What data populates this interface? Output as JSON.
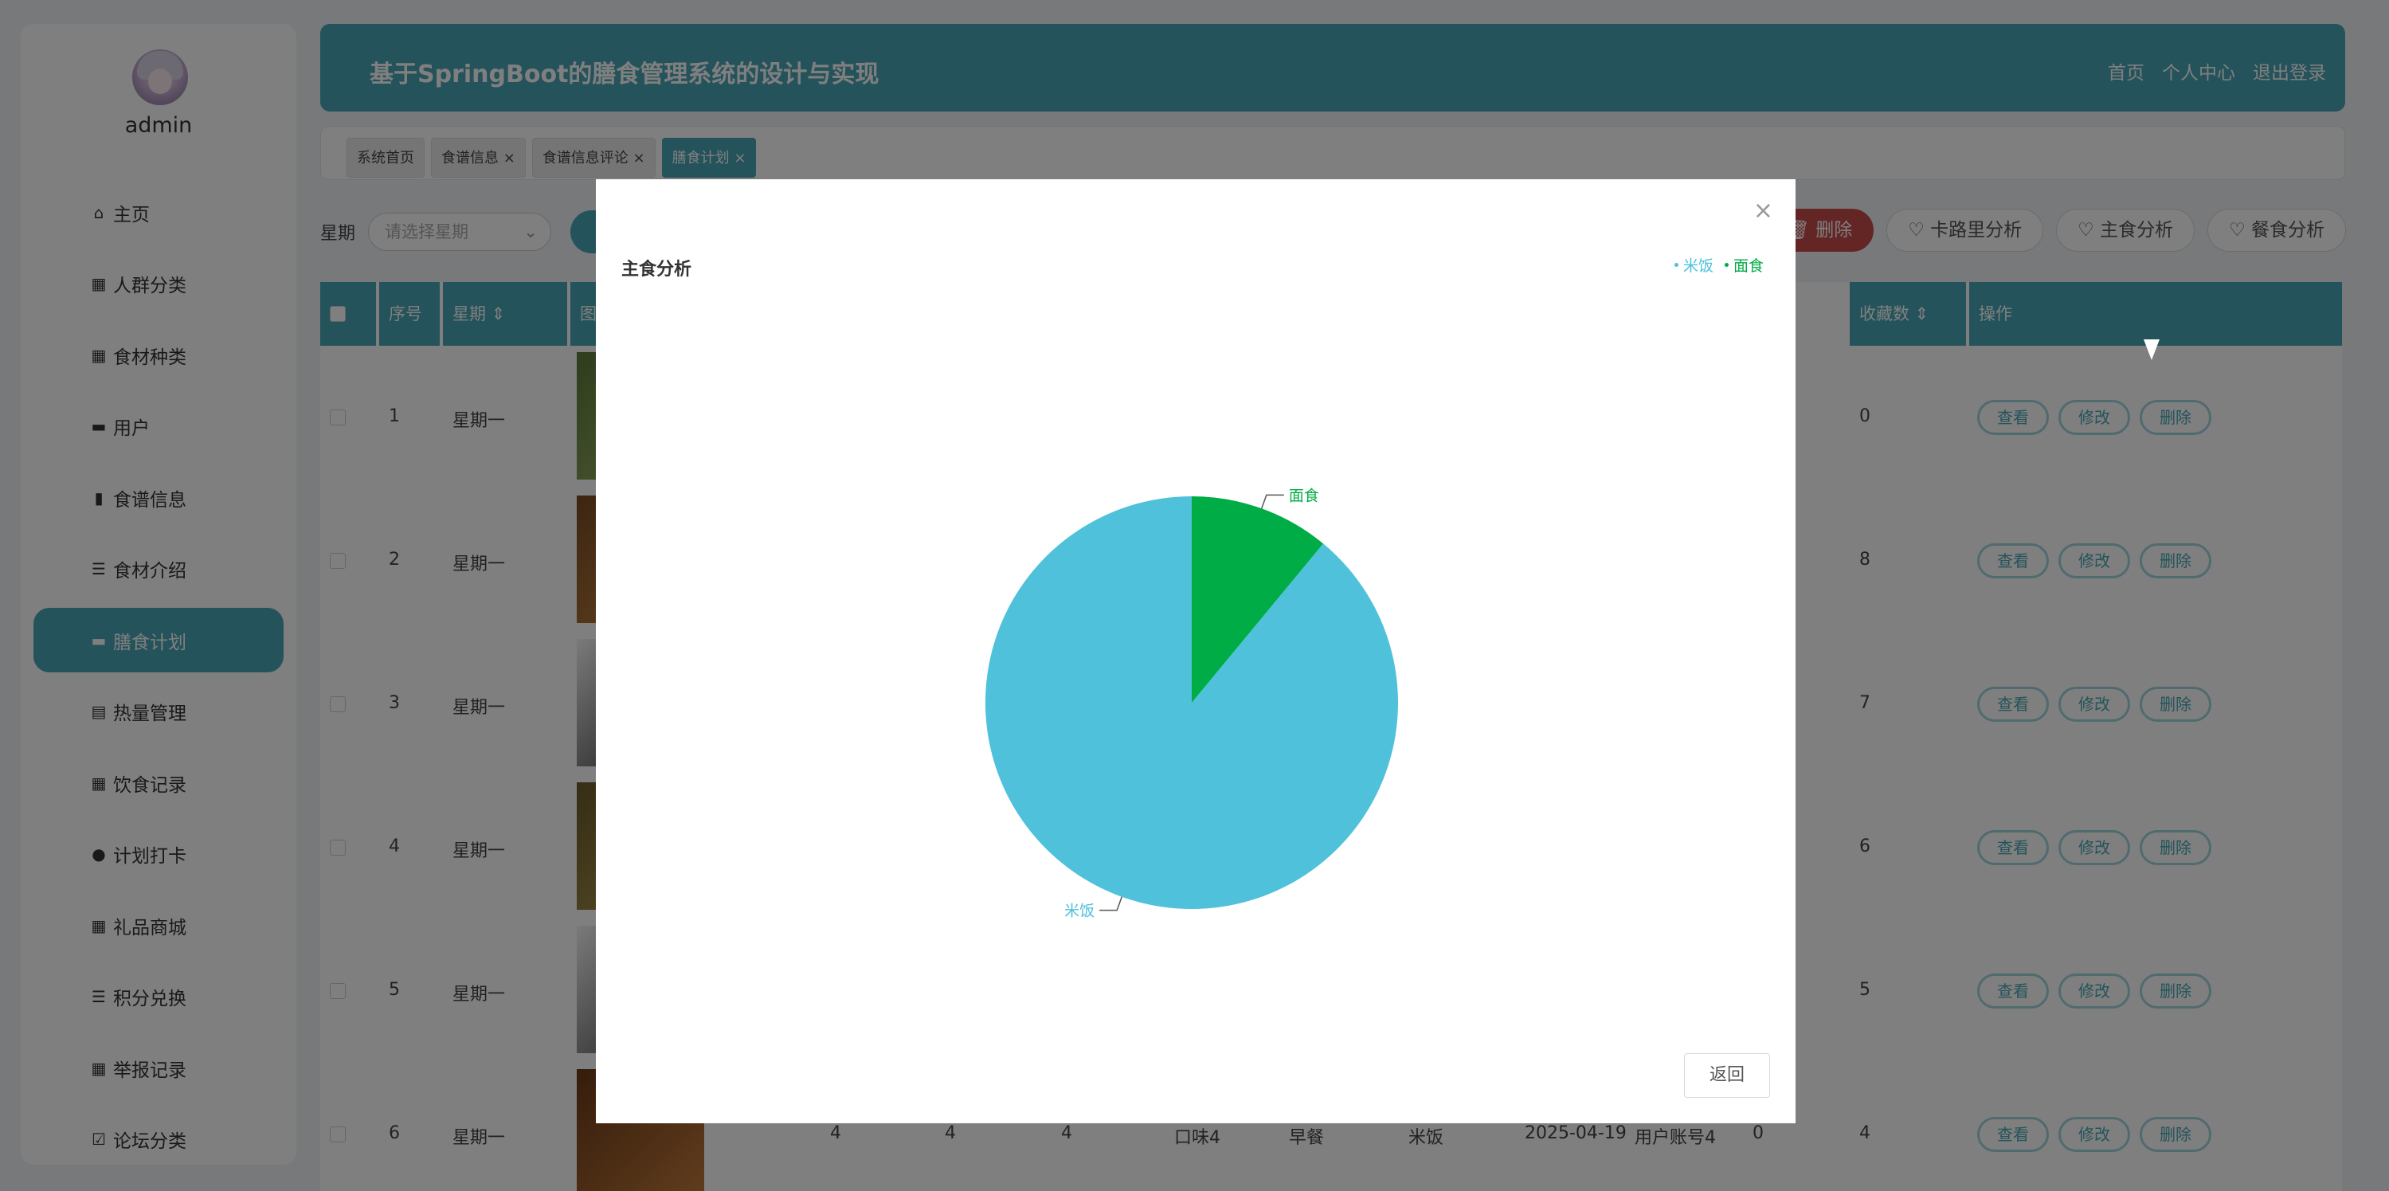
{
  "user": {
    "name": "admin"
  },
  "menu": [
    {
      "icon": "home-icon",
      "glyph": "⌂",
      "label": "主页"
    },
    {
      "icon": "grid-icon",
      "glyph": "▦",
      "label": "人群分类"
    },
    {
      "icon": "grid-icon",
      "glyph": "▦",
      "label": "食材种类"
    },
    {
      "icon": "monitor-icon",
      "glyph": "▬",
      "label": "用户"
    },
    {
      "icon": "bar-chart-icon",
      "glyph": "▮",
      "label": "食谱信息"
    },
    {
      "icon": "list-icon",
      "glyph": "☰",
      "label": "食材介绍"
    },
    {
      "icon": "monitor-icon",
      "glyph": "▬",
      "label": "膳食计划"
    },
    {
      "icon": "clipboard-icon",
      "glyph": "▤",
      "label": "热量管理"
    },
    {
      "icon": "grid-icon",
      "glyph": "▦",
      "label": "饮食记录"
    },
    {
      "icon": "user-icon",
      "glyph": "●",
      "label": "计划打卡"
    },
    {
      "icon": "grid-icon",
      "glyph": "▦",
      "label": "礼品商城"
    },
    {
      "icon": "list-icon",
      "glyph": "☰",
      "label": "积分兑换"
    },
    {
      "icon": "apps-icon",
      "glyph": "▦",
      "label": "举报记录"
    },
    {
      "icon": "checklist-icon",
      "glyph": "☑",
      "label": "论坛分类"
    }
  ],
  "header": {
    "title": "基于SpringBoot的膳食管理系统的设计与实现",
    "links": [
      "首页",
      "个人中心",
      "退出登录"
    ]
  },
  "tabs": [
    "系统首页",
    "食谱信息 ×",
    "食谱信息评论 ×",
    "膳食计划 ×"
  ],
  "filter": {
    "label": "星期",
    "placeholder": "请选择星期"
  },
  "actions": {
    "delete": "删除",
    "calorie": "卡路里分析",
    "staple": "主食分析",
    "meal": "餐食分析"
  },
  "table": {
    "headers": [
      "序号",
      "星期",
      "图",
      "收藏数",
      "操作"
    ],
    "rows": [
      {
        "no": "1",
        "day": "星期一",
        "fav": "0"
      },
      {
        "no": "2",
        "day": "星期一",
        "fav": "8"
      },
      {
        "no": "3",
        "day": "星期一",
        "fav": "7"
      },
      {
        "no": "4",
        "day": "星期一",
        "fav": "6"
      },
      {
        "no": "5",
        "day": "星期一",
        "fav": "5"
      },
      {
        "no": "6",
        "day": "星期一",
        "fav": "4"
      }
    ],
    "last_row_extra": [
      "4",
      "4",
      "4",
      "口味4",
      "早餐",
      "米饭",
      "2025-04-19",
      "用户账号4",
      "0"
    ],
    "row_buttons": [
      "查看",
      "修改",
      "删除"
    ]
  },
  "modal": {
    "back": "返回",
    "close": "×"
  },
  "chart_data": {
    "type": "pie",
    "title": "主食分析",
    "categories": [
      "米饭",
      "面食"
    ],
    "values": [
      89,
      11
    ],
    "colors": [
      "#4fc1db",
      "#00ac45"
    ],
    "legend": "top-right"
  }
}
